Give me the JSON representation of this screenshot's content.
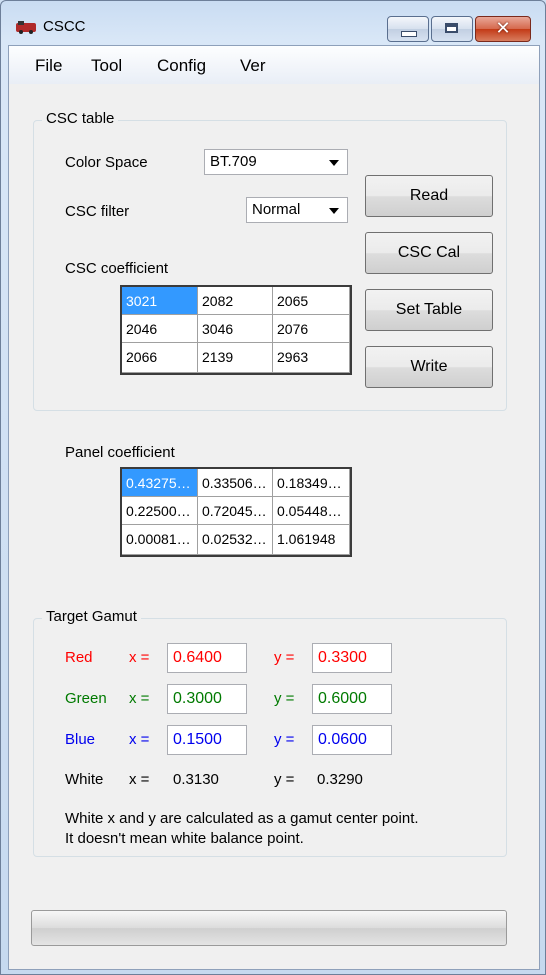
{
  "window": {
    "title": "CSCC"
  },
  "menu": [
    "File",
    "Tool",
    "Config",
    "Ver"
  ],
  "csc_table": {
    "title": "CSC table",
    "color_space_label": "Color Space",
    "color_space_value": "BT.709",
    "csc_filter_label": "CSC filter",
    "csc_filter_value": "Normal",
    "csc_coefficient_label": "CSC coefficient",
    "coefficients": [
      [
        "3021",
        "2082",
        "2065"
      ],
      [
        "2046",
        "3046",
        "2076"
      ],
      [
        "2066",
        "2139",
        "2963"
      ]
    ],
    "buttons": {
      "read": "Read",
      "csc_cal": "CSC Cal",
      "set_table": "Set Table",
      "write": "Write"
    }
  },
  "panel": {
    "label": "Panel coefficient",
    "coefficients": [
      [
        "0.43275…",
        "0.33506…",
        "0.18349…"
      ],
      [
        "0.22500…",
        "0.72045…",
        "0.05448…"
      ],
      [
        "0.00081…",
        "0.02532…",
        "1.061948"
      ]
    ]
  },
  "target_gamut": {
    "title": "Target Gamut",
    "x_label": "x =",
    "y_label": "y =",
    "rows": [
      {
        "name": "Red",
        "x": "0.6400",
        "y": "0.3300"
      },
      {
        "name": "Green",
        "x": "0.3000",
        "y": "0.6000"
      },
      {
        "name": "Blue",
        "x": "0.1500",
        "y": "0.0600"
      },
      {
        "name": "White",
        "x": "0.3130",
        "y": "0.3290"
      }
    ],
    "note_line1": "White x and y are calculated as a gamut center point.",
    "note_line2": "It doesn't mean white balance point."
  },
  "colors": {
    "red": "#ff0000",
    "green": "#007a00",
    "blue": "#0000ee",
    "selection": "#3399ff"
  }
}
